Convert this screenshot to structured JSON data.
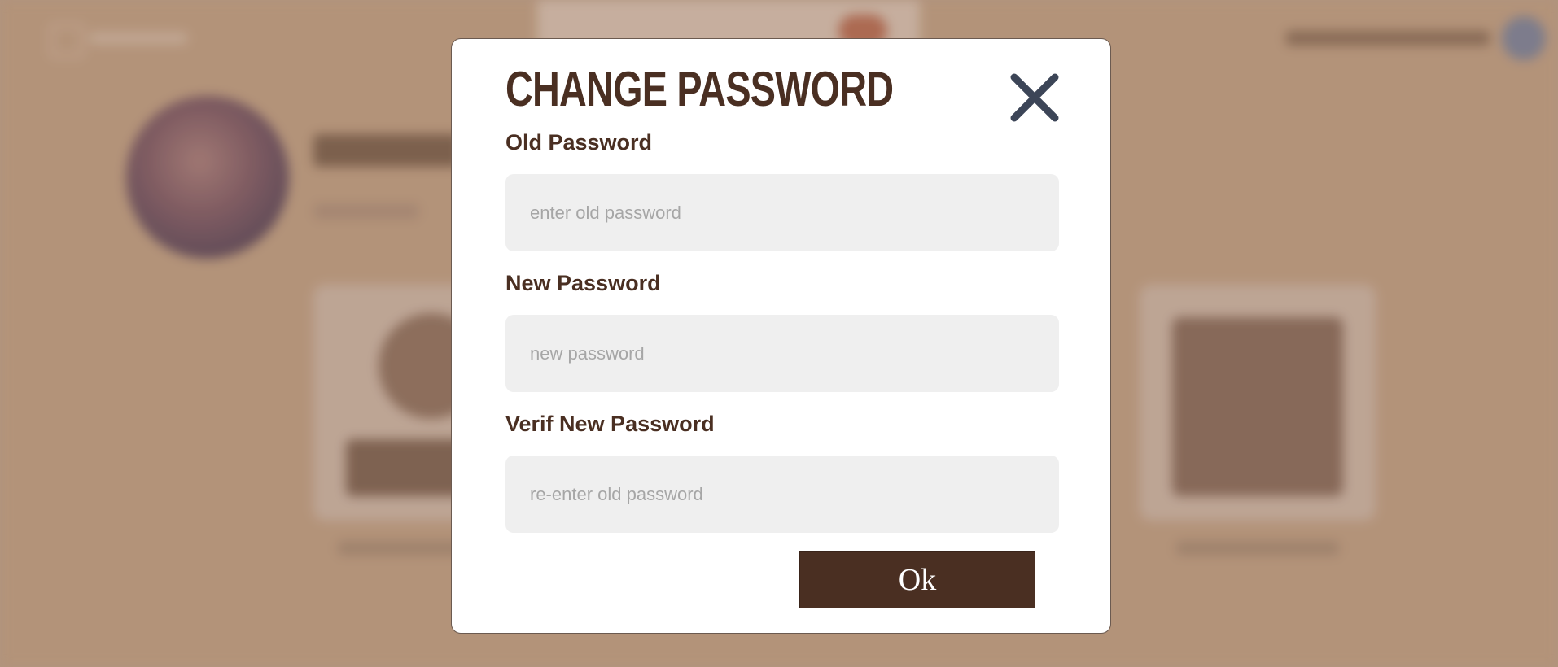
{
  "modal": {
    "title": "CHANGE PASSWORD",
    "close_icon": "close-icon",
    "fields": [
      {
        "label": "Old Password",
        "placeholder": "enter old password",
        "value": ""
      },
      {
        "label": "New Password",
        "placeholder": "new password",
        "value": ""
      },
      {
        "label": "Verif New Password",
        "placeholder": "re-enter old password",
        "value": ""
      }
    ],
    "ok_label": "Ok"
  },
  "colors": {
    "title": "#4a2f22",
    "button_bg": "#4a2f22",
    "input_bg": "#efefef",
    "close_icon": "#3c4557",
    "backdrop": "#b8997f"
  }
}
